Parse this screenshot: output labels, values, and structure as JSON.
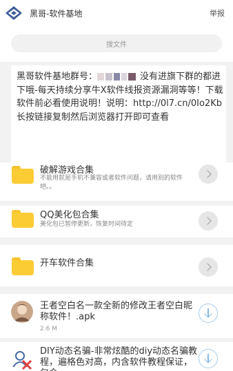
{
  "header": {
    "logo_icon": "diamond-logo-icon",
    "title": "黑哥-软件基地",
    "report_label": "举报"
  },
  "search": {
    "placeholder": "搜文件"
  },
  "notice": {
    "text_before": "黑哥软件基地群号：",
    "text_after": "没有进旗下群的都进下哦-每天持续分享牛X软件线报资源漏洞等等！下载软件前必看使用说明！说明：http://0l7.cn/0Io2Kb长按链接复制然后浏览器打开即可查看"
  },
  "folders": [
    {
      "title": "破解游戏合集",
      "desc": "不能用就是手机不兼容或者软件问题，请用别的软件吧。。",
      "icon": "folder-icon"
    },
    {
      "title": "QQ美化包合集",
      "desc": "美化包已暂停更新，恢复时间待定",
      "icon": "folder-icon"
    },
    {
      "title": "开车软件合集",
      "desc": "",
      "icon": "folder-icon"
    }
  ],
  "files": [
    {
      "title": "王者空白名一款全新的修改王者空白昵称软件！.apk",
      "size": "2.6 M",
      "icon": "avatar-icon"
    },
    {
      "title": "DIY动态名骗-非常炫酷的diy动态名骗教程，遍格色对高，内含软件教程保证，包会。。",
      "size": "",
      "icon": "diy-x-icon"
    }
  ],
  "colors": {
    "folder": "#fccc35",
    "download_ring": "#a9cbe9",
    "background": "#f2f2f2"
  }
}
